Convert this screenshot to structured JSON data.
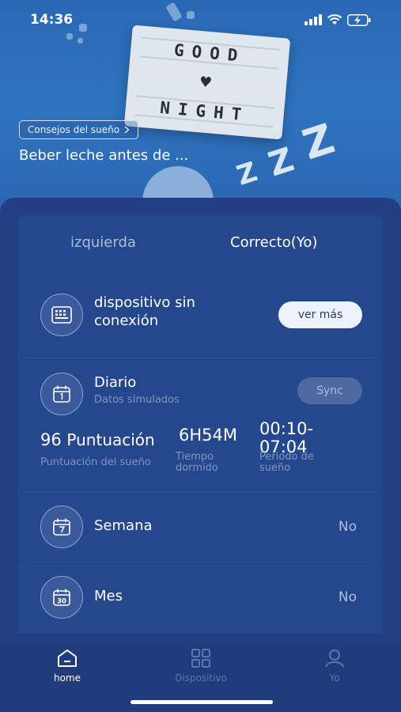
{
  "status_bar": {
    "time": "14:36"
  },
  "hero": {
    "lightbox_line1": "GOOD",
    "lightbox_line2": "NIGHT",
    "tips_badge": "Consejos del sueño",
    "tip_title": "Beber leche antes de ..."
  },
  "tabs": [
    {
      "label": "izquierda",
      "active": false
    },
    {
      "label": "Correcto(Yo)",
      "active": true
    }
  ],
  "device": {
    "status": "dispositivo sin conexión",
    "more_label": "ver más"
  },
  "daily": {
    "title": "Diario",
    "subtitle": "Datos simulados",
    "sync_label": "Sync",
    "score_value": "96",
    "score_unit": "Puntuación",
    "score_label": "Puntuación del sueño",
    "sleep_time_value": "6H54M",
    "sleep_time_label": "Tiempo dormido",
    "period_value": "00:10-07:04",
    "period_label": "Periodo de sueño"
  },
  "week": {
    "title": "Semana",
    "value": "No"
  },
  "month": {
    "title": "Mes",
    "value": "No",
    "icon_number": "30"
  },
  "nav": [
    {
      "label": "home",
      "icon": "home-icon",
      "active": true
    },
    {
      "label": "Dispositivo",
      "icon": "grid-icon",
      "active": false
    },
    {
      "label": "Yo",
      "icon": "user-icon",
      "active": false
    }
  ],
  "colors": {
    "background": "#1f3d7f",
    "card": "#25478d",
    "accent_white": "#ffffff",
    "muted_text": "#7f95bf"
  }
}
